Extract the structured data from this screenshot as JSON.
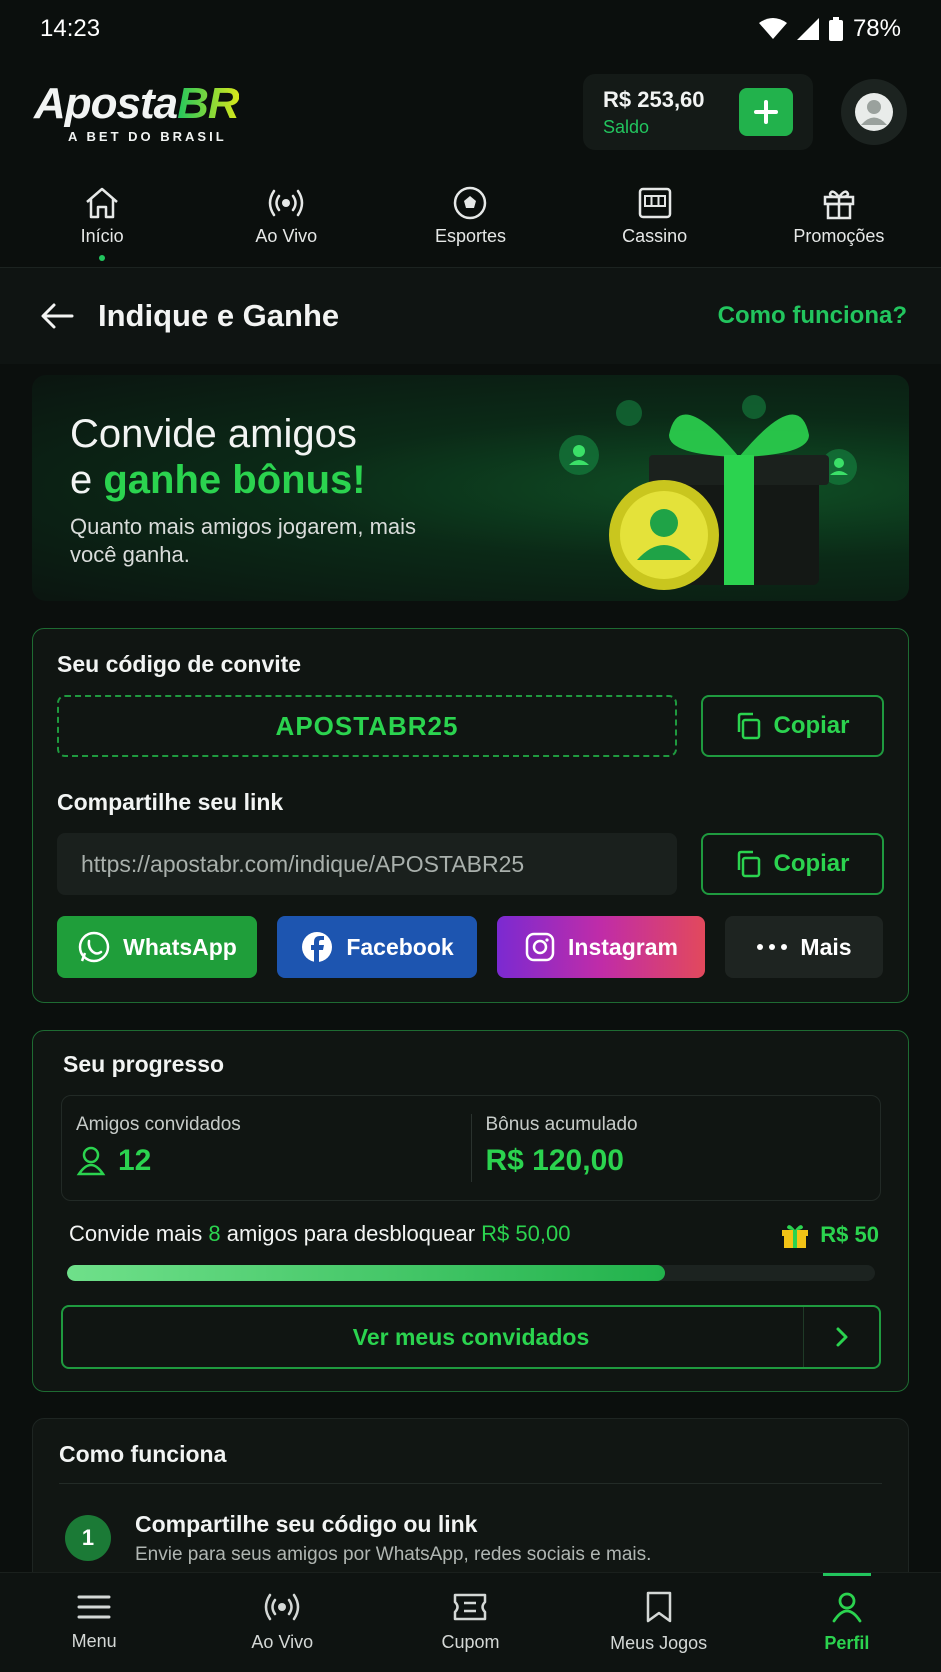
{
  "status": {
    "time": "14:23",
    "battery": "78%"
  },
  "header": {
    "logo_main": "Aposta",
    "logo_accent": "BR",
    "logo_tag": "A BET DO BRASIL",
    "balance": "R$ 253,60",
    "balance_label": "Saldo"
  },
  "topnav": [
    {
      "label": "Início",
      "icon": "home-icon",
      "active": true
    },
    {
      "label": "Ao Vivo",
      "icon": "live-icon"
    },
    {
      "label": "Esportes",
      "icon": "soccer-ball-icon"
    },
    {
      "label": "Cassino",
      "icon": "slot-machine-icon"
    },
    {
      "label": "Promoções",
      "icon": "gift-icon"
    }
  ],
  "page": {
    "title": "Indique e Ganhe",
    "help_link": "Como funciona?"
  },
  "hero": {
    "line1": "Convide amigos",
    "line2_prefix": "e ",
    "line2_highlight": "ganhe bônus!",
    "subtitle": "Quanto mais amigos jogarem, mais você ganha."
  },
  "invite": {
    "code_label": "Seu código de convite",
    "code": "APOSTABR25",
    "copy_label": "Copiar",
    "link_label": "Compartilhe seu link",
    "link": "https://apostabr.com/indique/APOSTABR25",
    "share": [
      {
        "label": "WhatsApp",
        "color": "#1f9e3a"
      },
      {
        "label": "Facebook",
        "color": "#1d55b0"
      },
      {
        "label": "Instagram"
      },
      {
        "label": "Mais",
        "color": "#1e2421"
      }
    ]
  },
  "progress": {
    "title": "Seu progresso",
    "friends_label": "Amigos convidados",
    "friends_value": "12",
    "bonus_label": "Bônus acumulado",
    "bonus_value": "R$ 120,00",
    "goal_prefix": "Convide mais ",
    "goal_count": "8",
    "goal_mid": " amigos para desbloquear ",
    "goal_amount": "R$ 50,00",
    "reward": "R$ 50",
    "fraction": 0.74,
    "see_button": "Ver meus convidados"
  },
  "how": {
    "title": "Como funciona",
    "steps": [
      {
        "num": "1",
        "title": "Compartilhe seu código ou link",
        "desc": "Envie para seus amigos por WhatsApp, redes sociais e mais."
      }
    ]
  },
  "bottomnav": [
    {
      "label": "Menu",
      "icon": "menu-icon"
    },
    {
      "label": "Ao Vivo",
      "icon": "live-icon"
    },
    {
      "label": "Cupom",
      "icon": "ticket-icon"
    },
    {
      "label": "Meus Jogos",
      "icon": "bookmark-icon"
    },
    {
      "label": "Perfil",
      "icon": "user-icon",
      "active": true
    }
  ]
}
